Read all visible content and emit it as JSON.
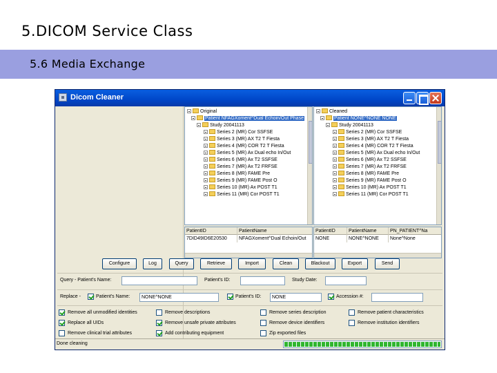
{
  "slide": {
    "title": "5.DICOM Service Class",
    "subtitle": "5.6 Media Exchange"
  },
  "window": {
    "title": "Dicom Cleaner"
  },
  "original_tree": {
    "root": "Original",
    "patient": "Patient NFAGXoment^Dual Echoin/Out Phase",
    "study": "Study 20041113",
    "series": [
      "Series 2 (MR) Cor SSFSE",
      "Series 3 (MR) AX T2 T Fiesta",
      "Series 4 (MR) COR T2 T Fiesta",
      "Series 5 (MR) Ax Dual echo In/Out",
      "Series 6 (MR) Ax T2 SSFSE",
      "Series 7 (MR) Ax T2 FRFSE",
      "Series 8 (MR) FAME Pre",
      "Series 9 (MR) FAME Post O",
      "Series 10 (MR) Ax POST T1",
      "Series 11 (MR) Cor POST T1"
    ]
  },
  "cleaned_tree": {
    "root": "Cleaned",
    "patient": "Patient NONE^NONE NONE",
    "study": "Study 20041113",
    "series": [
      "Series 2 (MR) Cor SSFSE",
      "Series 3 (MR) AX T2 T Fiesta",
      "Series 4 (MR) COR T2 T Fiesta",
      "Series 5 (MR) Ax Dual echo In/Out",
      "Series 6 (MR) Ax T2 SSFSE",
      "Series 7 (MR) Ax T2 FRFSE",
      "Series 8 (MR) FAME Pre",
      "Series 9 (MR) FAME Post O",
      "Series 10 (MR) Ax POST T1",
      "Series 11 (MR) Cor POST T1"
    ]
  },
  "original_table": {
    "headers": [
      "PatientID",
      "PatientName"
    ],
    "row": [
      "7DID49ID6E20530",
      "NFAGXoment^Dual Echoin/Out"
    ]
  },
  "cleaned_table": {
    "headers": [
      "PatientID",
      "PatientName",
      "PN_PATIENT^Na"
    ],
    "row": [
      "NONE",
      "NONE^NONE",
      "None^None"
    ]
  },
  "buttons": [
    "Configure",
    "Log",
    "Query",
    "Retrieve",
    "Import",
    "Clean",
    "Blackout",
    "Export",
    "Send"
  ],
  "search": {
    "query_label": "Query - Patient's Name:",
    "patient_id_label": "Patient's ID:",
    "study_date_label": "Study Date:",
    "query_value": "",
    "patient_id_value": "",
    "study_date_value": ""
  },
  "replace": {
    "label": "Replace -",
    "patient_name_label": "Patient's Name:",
    "patient_name_value": "NONE^NONE",
    "patient_id_label": "Patient's ID:",
    "patient_id_value": "NONE",
    "accession_label": "Accession #:",
    "accession_value": ""
  },
  "options": [
    {
      "label": "Remove all unmodified identities",
      "checked": true
    },
    {
      "label": "Remove descriptions",
      "checked": false
    },
    {
      "label": "Remove series description",
      "checked": false
    },
    {
      "label": "Remove patient characteristics",
      "checked": false
    },
    {
      "label": "Replace all UIDs",
      "checked": true
    },
    {
      "label": "Remove unsafe private attributes",
      "checked": true
    },
    {
      "label": "Remove device identifiers",
      "checked": false
    },
    {
      "label": "Remove institution identifiers",
      "checked": false
    },
    {
      "label": "Remove clinical trial attributes",
      "checked": false
    },
    {
      "label": "Add contributing equipment",
      "checked": true
    },
    {
      "label": "Zip exported files",
      "checked": false
    }
  ],
  "status": {
    "text": "Done cleaning",
    "progress": 1.0
  },
  "colors": {
    "band": "#9a9fe0",
    "titlebar": "#0046c8",
    "selection": "#316ac5",
    "progress": "#2fb52f"
  }
}
